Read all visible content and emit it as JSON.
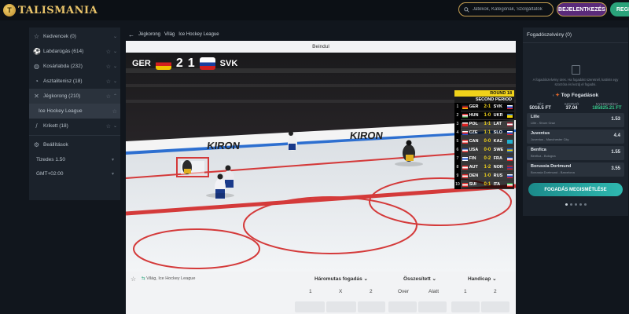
{
  "header": {
    "logo_text": "TALISMANIA",
    "search_placeholder": "Játékok, Kategóriák, Szolgáltatók",
    "login_label": "BEJELENTKEZÉS",
    "register_label": "REGI"
  },
  "sidebar": {
    "items": [
      {
        "label": "Kedvencek (0)",
        "icon": "star-icon"
      },
      {
        "label": "Labdarúgás (614)",
        "icon": "soccer-ball-icon"
      },
      {
        "label": "Kosárlabda (232)",
        "icon": "basketball-icon"
      },
      {
        "label": "Asztalitenisz (18)",
        "icon": "table-tennis-icon"
      },
      {
        "label": "Jégkorong (210)",
        "icon": "hockey-sticks-icon"
      },
      {
        "label": "Ice Hockey League",
        "icon": ""
      },
      {
        "label": "Krikett (18)",
        "icon": "cricket-icon"
      }
    ],
    "settings_label": "Beállítások",
    "odds_format": "Tizedes 1.50",
    "timezone": "GMT+02:00"
  },
  "breadcrumb": {
    "items": [
      "Jégkorong",
      "Világ",
      "Ice Hockey League"
    ]
  },
  "video": {
    "status": "Beindul",
    "home_team": "GER",
    "home_score": "2",
    "away_score": "1",
    "away_team": "SVK",
    "round": "ROUND 18",
    "period": "SECOND PERIOD",
    "rink_ad": "KIRON",
    "standings": [
      {
        "num": "1",
        "home": "GER",
        "score": "2-1",
        "away": "SVK",
        "hf": "#222,#d22,#f0c000",
        "af": "#fff,#1a4fd0,#d22"
      },
      {
        "num": "2",
        "home": "HUN",
        "score": "1-0",
        "away": "UKR",
        "hf": "#d22,#fff,#3a8a3a",
        "af": "#1a5fd0,#f0d000,#f0d000"
      },
      {
        "num": "3",
        "home": "POL",
        "score": "1-1",
        "away": "LAT",
        "hf": "#fff,#d22,#d22",
        "af": "#9b1b30,#fff,#9b1b30"
      },
      {
        "num": "4",
        "home": "CZE",
        "score": "1-1",
        "away": "SLO",
        "hf": "#fff,#d22,#1a4fd0",
        "af": "#fff,#1a4fd0,#d22"
      },
      {
        "num": "5",
        "home": "CAN",
        "score": "0-0",
        "away": "KAZ",
        "hf": "#d22,#fff,#d22",
        "af": "#20b0d0,#20b0d0,#20b0d0"
      },
      {
        "num": "6",
        "home": "USA",
        "score": "0-0",
        "away": "SWE",
        "hf": "#1a3fa0,#fff,#d22",
        "af": "#1a5fd0,#f0d000,#1a5fd0"
      },
      {
        "num": "7",
        "home": "FIN",
        "score": "0-2",
        "away": "FRA",
        "hf": "#fff,#1a4fd0,#fff",
        "af": "#1a3fa0,#fff,#d22"
      },
      {
        "num": "8",
        "home": "AUT",
        "score": "1-2",
        "away": "NOR",
        "hf": "#d22,#fff,#d22",
        "af": "#d22,#1a3fa0,#d22"
      },
      {
        "num": "9",
        "home": "DEN",
        "score": "1-0",
        "away": "RUS",
        "hf": "#d22,#fff,#d22",
        "af": "#fff,#1a4fd0,#d22"
      },
      {
        "num": "10",
        "home": "SUI",
        "score": "0-1",
        "away": "ITA",
        "hf": "#d22,#fff,#d22",
        "af": "#2a9a3a,#fff,#d22"
      }
    ]
  },
  "betting": {
    "league": "Világ, Ice Hockey League",
    "markets": [
      "Háromutas fogadás",
      "Összesített",
      "Handicap"
    ],
    "cols": [
      "1",
      "X",
      "2",
      "Over",
      "Alatt",
      "1",
      "2"
    ]
  },
  "slip": {
    "title": "Fogadószelvény (0)",
    "empty_msg": "A fogadószelvény üres. Ha fogadást szeretnél, kattints egy szorzóra és kezdj el fogadni.",
    "top_bets_title": "Top Fogadások",
    "stake_label": "TÉT",
    "stake_value": "5016.5 FT",
    "odds_label": "SZORZÓ",
    "odds_value": "37.04",
    "win_label": "NYEREMÉNY",
    "win_value": "185825.21 FT",
    "picks": [
      {
        "name": "Lille",
        "match": "Lille - Strum Graz",
        "odd": "1.53"
      },
      {
        "name": "Juventus",
        "match": "Juventus - Manchester City",
        "odd": "4.4"
      },
      {
        "name": "Benfica",
        "match": "Benfica - Bologna",
        "odd": "1.55"
      },
      {
        "name": "Borussia Dortmund",
        "match": "Borussia Dortmund - Barcelona",
        "odd": "3.55"
      }
    ],
    "button_label": "FOGADÁS MEGISMÉTLÉSE"
  }
}
